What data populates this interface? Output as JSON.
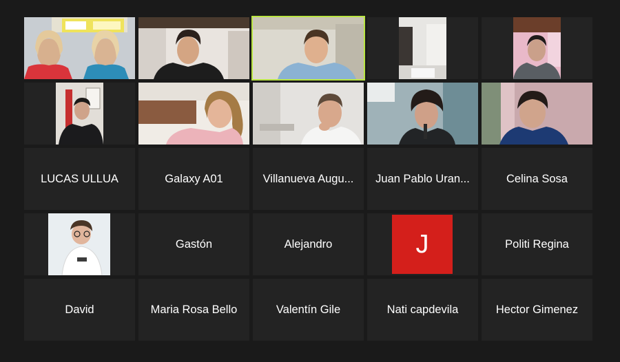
{
  "meeting": {
    "view": "gallery",
    "active_speaker": "participant-3",
    "colors": {
      "background": "#1a1a1a",
      "tile": "#232323",
      "active_speaker_border": "#b9e542",
      "name_text": "#ffffff",
      "letter_avatar": "#d41f1b"
    }
  },
  "participants": [
    {
      "id": "participant-1",
      "type": "video"
    },
    {
      "id": "participant-2",
      "type": "video"
    },
    {
      "id": "participant-3",
      "type": "video",
      "active_speaker": true
    },
    {
      "id": "participant-4",
      "type": "video"
    },
    {
      "id": "participant-5",
      "type": "video"
    },
    {
      "id": "participant-6",
      "type": "video"
    },
    {
      "id": "participant-7",
      "type": "video"
    },
    {
      "id": "participant-8",
      "type": "video"
    },
    {
      "id": "participant-9",
      "type": "video"
    },
    {
      "id": "participant-10",
      "type": "video"
    },
    {
      "id": "participant-11",
      "type": "name",
      "name": "LUCAS ULLUA"
    },
    {
      "id": "participant-12",
      "type": "name",
      "name": "Galaxy A01"
    },
    {
      "id": "participant-13",
      "type": "name",
      "name": "Villanueva Augu..."
    },
    {
      "id": "participant-14",
      "type": "name",
      "name": "Juan Pablo Uran..."
    },
    {
      "id": "participant-15",
      "type": "name",
      "name": "Celina Sosa"
    },
    {
      "id": "participant-16",
      "type": "photo"
    },
    {
      "id": "participant-17",
      "type": "name",
      "name": "Gastón"
    },
    {
      "id": "participant-18",
      "type": "name",
      "name": "Alejandro"
    },
    {
      "id": "participant-19",
      "type": "letter",
      "letter": "J"
    },
    {
      "id": "participant-20",
      "type": "name",
      "name": "Politi Regina"
    },
    {
      "id": "participant-21",
      "type": "name",
      "name": "David"
    },
    {
      "id": "participant-22",
      "type": "name",
      "name": "Maria Rosa Bello"
    },
    {
      "id": "participant-23",
      "type": "name",
      "name": "Valentín Gile"
    },
    {
      "id": "participant-24",
      "type": "name",
      "name": "Nati capdevila"
    },
    {
      "id": "participant-25",
      "type": "name",
      "name": "Hector Gimenez"
    }
  ]
}
